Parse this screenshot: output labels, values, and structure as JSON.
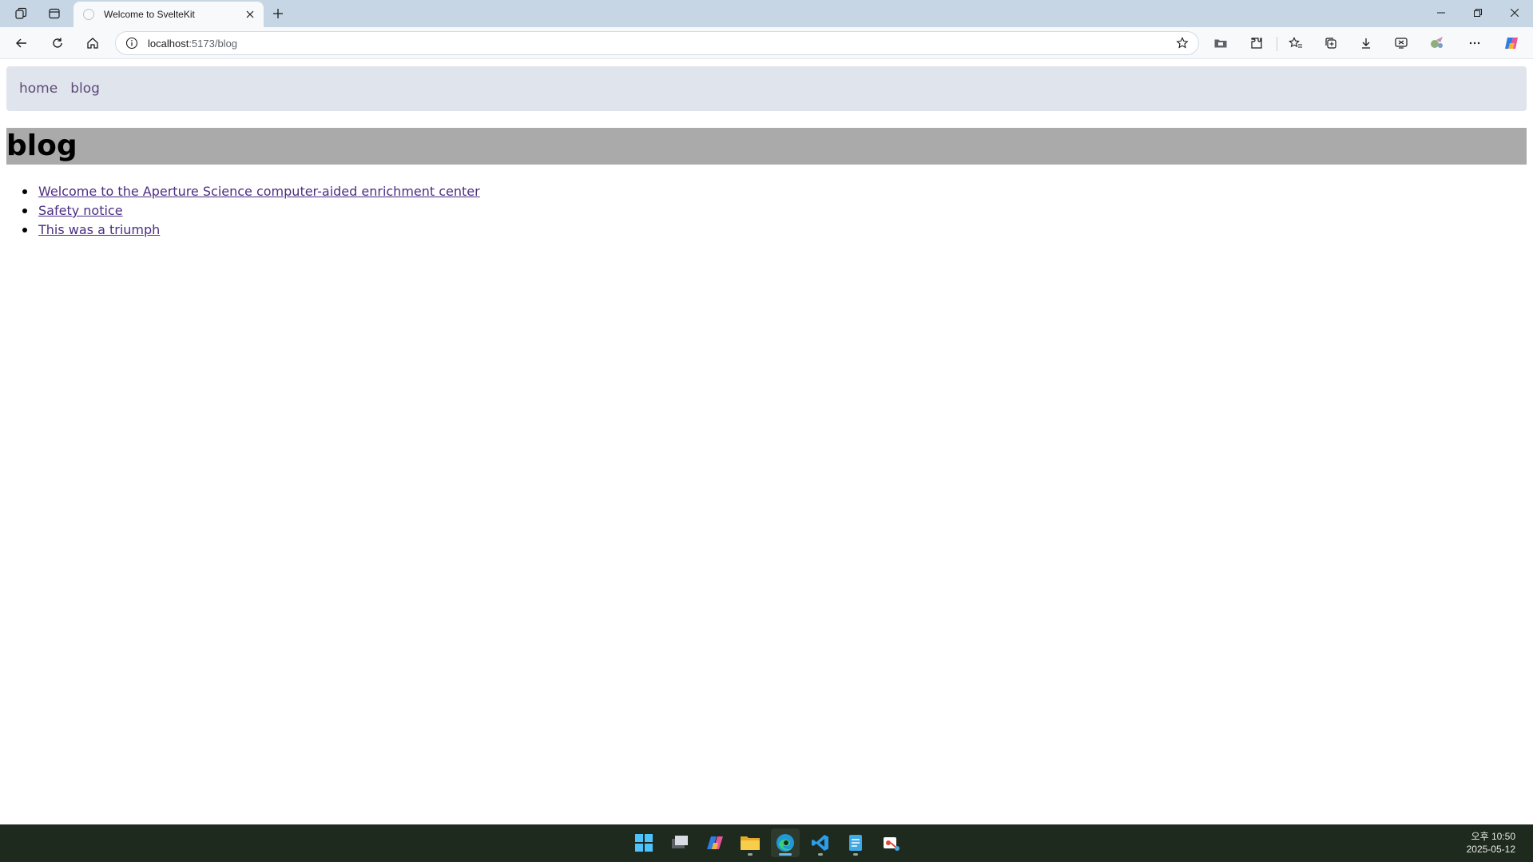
{
  "browser": {
    "tab_title": "Welcome to SvelteKit",
    "url_host": "localhost",
    "url_rest": ":5173/blog",
    "window_controls": [
      "minimize-icon",
      "restore-icon",
      "close-icon"
    ]
  },
  "site": {
    "nav": [
      {
        "label": "home"
      },
      {
        "label": "blog"
      }
    ],
    "heading": "blog",
    "posts": [
      {
        "title": "Welcome to the Aperture Science computer-aided enrichment center"
      },
      {
        "title": "Safety notice"
      },
      {
        "title": "This was a triumph"
      }
    ],
    "colors": {
      "nav_bg": "#e0e4ec",
      "heading_bg": "#aaaaaa",
      "link": "#4b2e83"
    }
  },
  "taskbar": {
    "icons": [
      "windows-start-icon",
      "task-view-icon",
      "copilot-icon",
      "file-explorer-icon",
      "edge-icon",
      "vscode-icon",
      "notepad-icon",
      "snipping-tool-icon"
    ],
    "time": "오후 10:50",
    "date": "2025-05-12"
  }
}
